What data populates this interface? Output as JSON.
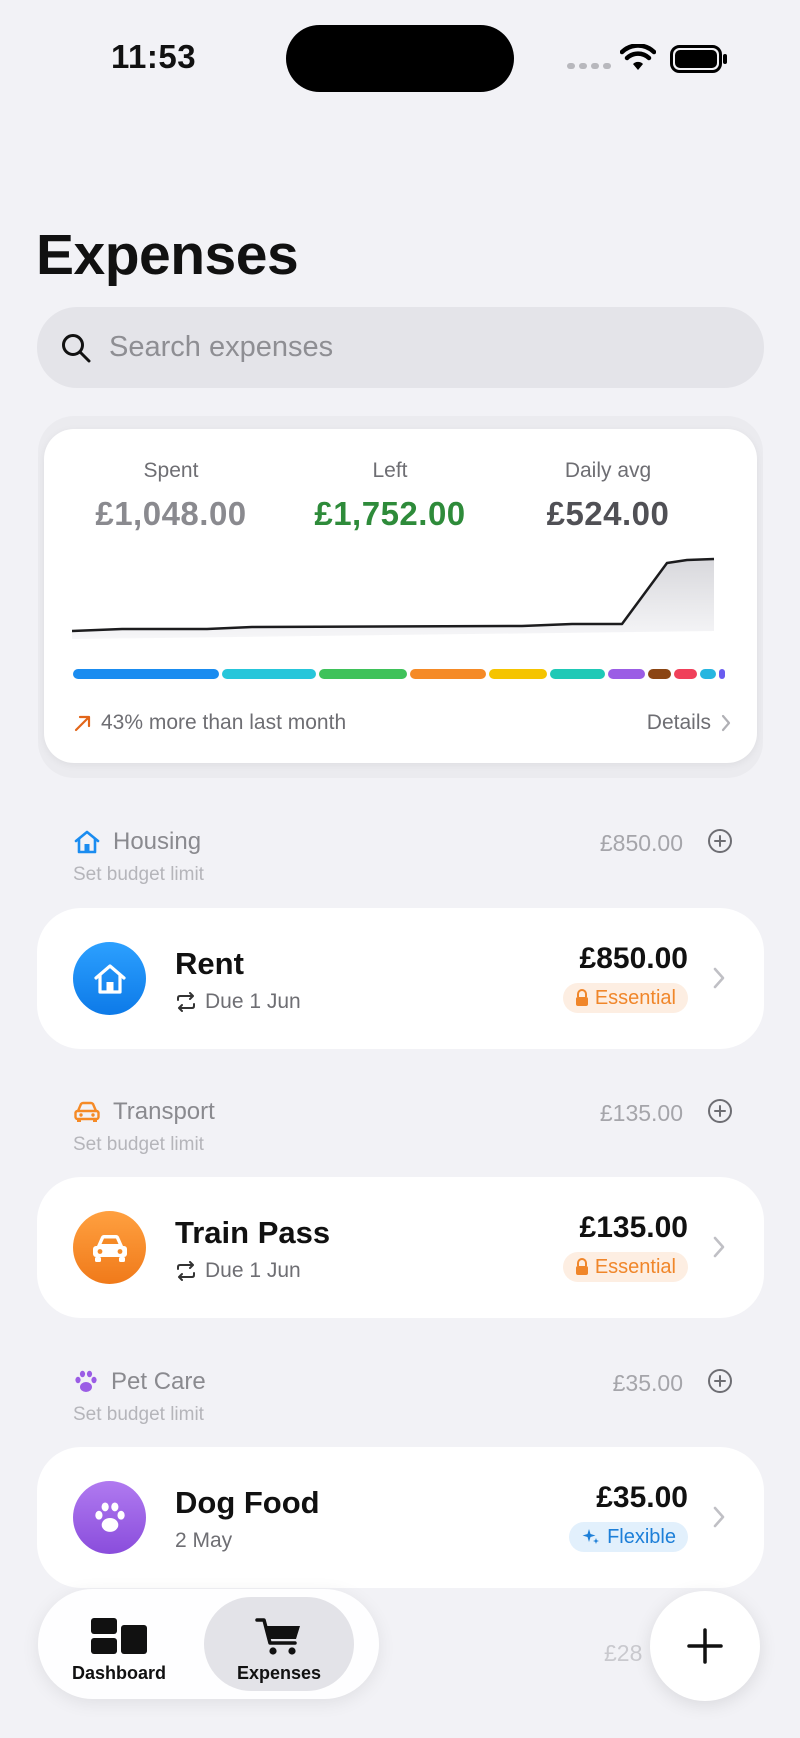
{
  "status_bar": {
    "time": "11:53"
  },
  "page": {
    "title": "Expenses"
  },
  "search": {
    "placeholder": "Search expenses"
  },
  "summary": {
    "spent_label": "Spent",
    "spent_value": "£1,048.00",
    "left_label": "Left",
    "left_value": "£1,752.00",
    "avg_label": "Daily avg",
    "avg_value": "£524.00",
    "trend_text": "43% more than last month",
    "details_label": "Details"
  },
  "sections": [
    {
      "category": "Housing",
      "category_amount": "£850.00",
      "budget_hint": "Set budget limit",
      "item": {
        "title": "Rent",
        "meta": "Due 1 Jun",
        "price": "£850.00",
        "badge": "Essential"
      }
    },
    {
      "category": "Transport",
      "category_amount": "£135.00",
      "budget_hint": "Set budget limit",
      "item": {
        "title": "Train Pass",
        "meta": "Due 1 Jun",
        "price": "£135.00",
        "badge": "Essential"
      }
    },
    {
      "category": "Pet Care",
      "category_amount": "£35.00",
      "budget_hint": "Set budget limit",
      "item": {
        "title": "Dog Food",
        "meta": "2 May",
        "price": "£35.00",
        "badge": "Flexible"
      }
    }
  ],
  "partial_amount": "£28",
  "tabs": {
    "dashboard": "Dashboard",
    "expenses": "Expenses"
  },
  "colors": {
    "housing": "#1a8cf0",
    "transport": "#f58a26",
    "pet_care": "#9b5de5",
    "spent": "#8a8a8f",
    "left": "#2e8b3a"
  }
}
